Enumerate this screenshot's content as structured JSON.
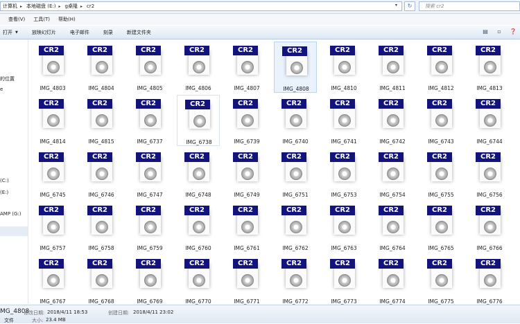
{
  "address": {
    "breadcrumbs": [
      "计算机",
      "本地磁盘 (E:)",
      "g桌隆",
      "cr2"
    ],
    "search_placeholder": "搜索 cr2"
  },
  "menu": [
    "查看(V)",
    "工具(T)",
    "帮助(H)"
  ],
  "toolbar": {
    "open_label": "打开",
    "slideshow_label": "放映幻灯片",
    "email_label": "电子邮件",
    "burn_label": "刻录",
    "new_folder_label": "新建文件夹"
  },
  "nav": {
    "items": [
      "的位置",
      "e",
      "(C:)",
      "(E:)",
      "AMP (G:)"
    ]
  },
  "badge_text": "CR2",
  "files": [
    "IMG_4803",
    "IMG_4804",
    "IMG_4805",
    "IMG_4806",
    "IMG_4807",
    "IMG_4808",
    "IMG_4810",
    "IMG_4811",
    "IMG_4812",
    "IMG_4813",
    "IMG_4814",
    "IMG_4815",
    "IMG_6737",
    "IMG_6738",
    "IMG_6739",
    "IMG_6740",
    "IMG_6741",
    "IMG_6742",
    "IMG_6743",
    "IMG_6744",
    "IMG_6745",
    "IMG_6746",
    "IMG_6747",
    "IMG_6748",
    "IMG_6749",
    "IMG_6751",
    "IMG_6753",
    "IMG_6754",
    "IMG_6755",
    "IMG_6756",
    "IMG_6757",
    "IMG_6758",
    "IMG_6759",
    "IMG_6760",
    "IMG_6761",
    "IMG_6762",
    "IMG_6763",
    "IMG_6764",
    "IMG_6765",
    "IMG_6766",
    "IMG_6767",
    "IMG_6768",
    "IMG_6769",
    "IMG_6770",
    "IMG_6771",
    "IMG_6772",
    "IMG_6773",
    "IMG_6774",
    "IMG_6775",
    "IMG_6776"
  ],
  "selected_file": "IMG_4808",
  "details": {
    "name": "MG_4808",
    "modified_label": "修改日期:",
    "modified_value": "2018/4/11 18:53",
    "created_label": "创建日期:",
    "created_value": "2018/4/11 23:02",
    "type": "文件",
    "size_label": "大小:",
    "size_value": "23.4 MB"
  },
  "colors": {
    "badge": "#13137e",
    "selection": "#eaf2fc"
  }
}
